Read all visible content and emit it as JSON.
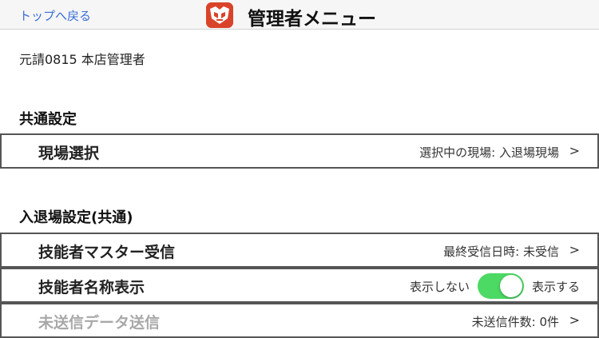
{
  "nav": {
    "back_label": "トップへ戻る",
    "title": "管理者メニュー"
  },
  "company_name": "元請0815 本店管理者",
  "sections": [
    {
      "header": "共通設定",
      "rows": [
        {
          "label": "現場選択",
          "value": "選択中の現場: 入退場現場",
          "chevron": ">"
        }
      ]
    },
    {
      "header": "入退場設定(共通)",
      "rows": [
        {
          "label": "技能者マスター受信",
          "value": "最終受信日時: 未受信",
          "chevron": ">"
        },
        {
          "label": "技能者名称表示",
          "toggle_off_label": "表示しない",
          "toggle_on_label": "表示する",
          "toggle_on": true
        },
        {
          "label": "未送信データ送信",
          "value": "未送信件数: 0件",
          "chevron": ">",
          "disabled": true
        }
      ]
    }
  ],
  "colors": {
    "link": "#3a6ed8",
    "toggle_on": "#4cd964",
    "logo": "#d9432a"
  }
}
